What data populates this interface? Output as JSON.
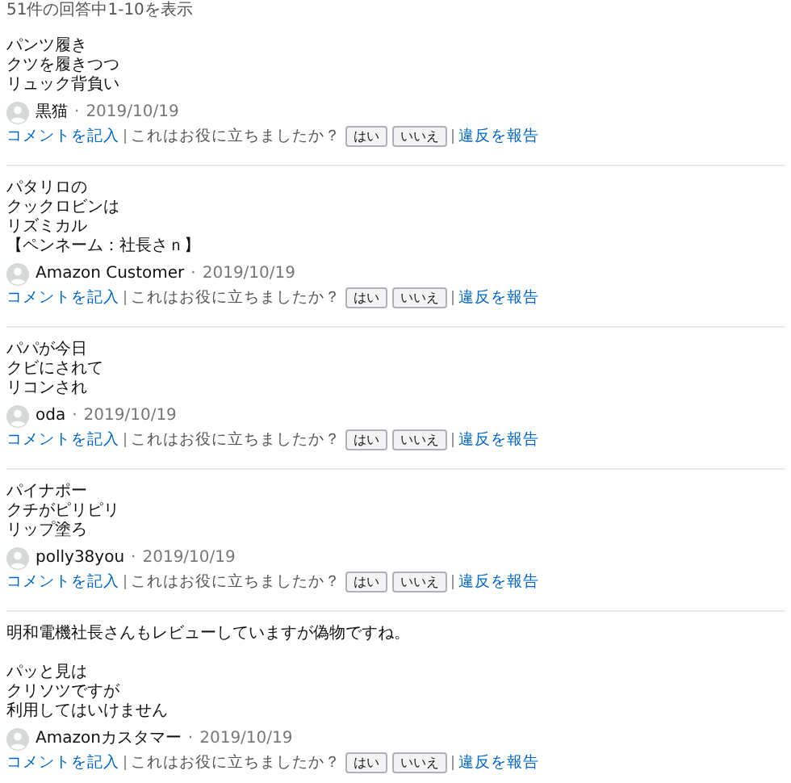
{
  "summary": "51件の回答中1-10を表示",
  "answers": [
    {
      "paragraphs": [
        [
          "パンツ履き",
          "クツを履きつつ",
          "リュック背負い"
        ]
      ],
      "author": "黒猫",
      "separator": "·",
      "date": "2019/10/19",
      "comment": "コメントを記入",
      "helpful": "これはお役に立ちましたか？",
      "yes": "はい",
      "no": "いいえ",
      "report": "違反を報告"
    },
    {
      "paragraphs": [
        [
          "パタリロの",
          "クックロビンは",
          "リズミカル",
          "【ペンネーム：社長さｎ】"
        ]
      ],
      "author": "Amazon Customer",
      "separator": "·",
      "date": "2019/10/19",
      "comment": "コメントを記入",
      "helpful": "これはお役に立ちましたか？",
      "yes": "はい",
      "no": "いいえ",
      "report": "違反を報告"
    },
    {
      "paragraphs": [
        [
          "パパが今日",
          "クビにされて",
          "リコンされ"
        ]
      ],
      "author": "oda",
      "separator": "·",
      "date": "2019/10/19",
      "comment": "コメントを記入",
      "helpful": "これはお役に立ちましたか？",
      "yes": "はい",
      "no": "いいえ",
      "report": "違反を報告"
    },
    {
      "paragraphs": [
        [
          "パイナポー",
          "クチがピリピリ",
          "リップ塗ろ"
        ]
      ],
      "author": "polly38you",
      "separator": "·",
      "date": "2019/10/19",
      "comment": "コメントを記入",
      "helpful": "これはお役に立ちましたか？",
      "yes": "はい",
      "no": "いいえ",
      "report": "違反を報告"
    },
    {
      "paragraphs": [
        [
          "明和電機社長さんもレビューしていますが偽物ですね。"
        ],
        [
          "パッと見は",
          "クリソツですが",
          "利用してはいけません"
        ]
      ],
      "author": "Amazonカスタマー",
      "separator": "·",
      "date": "2019/10/19",
      "comment": "コメントを記入",
      "helpful": "これはお役に立ちましたか？",
      "yes": "はい",
      "no": "いいえ",
      "report": "違反を報告"
    }
  ]
}
